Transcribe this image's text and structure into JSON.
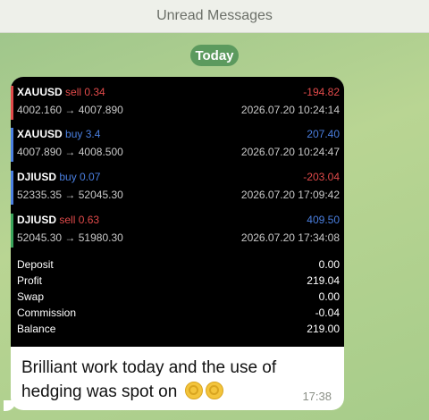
{
  "header": {
    "unread_label": "Unread Messages"
  },
  "date_pill": {
    "label": "Today"
  },
  "trades": [
    {
      "symbol": "XAUUSD",
      "side": "sell 0.34",
      "side_type": "sell",
      "open": "4002.160",
      "arrow": "→",
      "close": "4007.890",
      "profit": "-194.82",
      "time": "2026.07.20 10:24:14"
    },
    {
      "symbol": "XAUUSD",
      "side": "buy 3.4",
      "side_type": "buy",
      "open": "4007.890",
      "arrow": "→",
      "close": "4008.500",
      "profit": "207.40",
      "time": "2026.07.20 10:24:47"
    },
    {
      "symbol": "DJIUSD",
      "side": "buy 0.07",
      "side_type": "buy",
      "open": "52335.35",
      "arrow": "→",
      "close": "52045.30",
      "profit": "-203.04",
      "time": "2026.07.20 17:09:42"
    },
    {
      "symbol": "DJIUSD",
      "side": "sell 0.63",
      "side_type": "sell",
      "open": "52045.30",
      "arrow": "→",
      "close": "51980.30",
      "profit": "409.50",
      "time": "2026.07.20 17:34:08"
    }
  ],
  "summary": [
    {
      "label": "Deposit",
      "value": "0.00"
    },
    {
      "label": "Profit",
      "value": "219.04"
    },
    {
      "label": "Swap",
      "value": "0.00"
    },
    {
      "label": "Commission",
      "value": "-0.04"
    },
    {
      "label": "Balance",
      "value": "219.00"
    }
  ],
  "message": {
    "text": "Brilliant work today and the use of hedging was spot on",
    "time": "17:38",
    "emojis": [
      "ok-hand-icon",
      "ok-hand-icon"
    ]
  },
  "colors": {
    "sell": "#e04a4a",
    "buy": "#4a7fe0",
    "date_pill": "#5c9a5e",
    "bar_sell": "#e04a4a",
    "bar_buy": "#4a7fe0"
  }
}
